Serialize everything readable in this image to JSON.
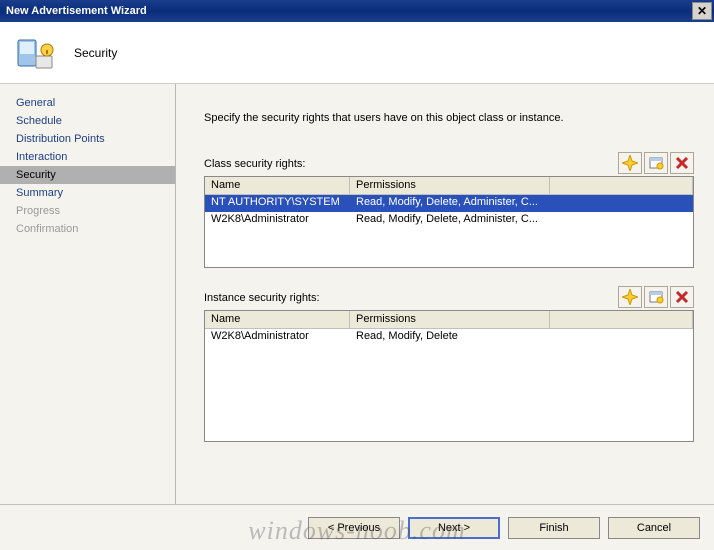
{
  "window": {
    "title": "New Advertisement Wizard",
    "close_glyph": "✕"
  },
  "header": {
    "title": "Security"
  },
  "sidebar": {
    "items": [
      {
        "label": "General",
        "state": "link"
      },
      {
        "label": "Schedule",
        "state": "link"
      },
      {
        "label": "Distribution Points",
        "state": "link"
      },
      {
        "label": "Interaction",
        "state": "link"
      },
      {
        "label": "Security",
        "state": "active"
      },
      {
        "label": "Summary",
        "state": "link"
      },
      {
        "label": "Progress",
        "state": "disabled"
      },
      {
        "label": "Confirmation",
        "state": "disabled"
      }
    ]
  },
  "content": {
    "instruction": "Specify the security rights that users have on this object class or instance.",
    "class_section": {
      "label": "Class security rights:",
      "columns": {
        "name": "Name",
        "permissions": "Permissions"
      },
      "rows": [
        {
          "name": "NT AUTHORITY\\SYSTEM",
          "permissions": "Read, Modify, Delete, Administer, C...",
          "selected": true
        },
        {
          "name": "W2K8\\Administrator",
          "permissions": "Read, Modify, Delete, Administer, C...",
          "selected": false
        }
      ]
    },
    "instance_section": {
      "label": "Instance security rights:",
      "columns": {
        "name": "Name",
        "permissions": "Permissions"
      },
      "rows": [
        {
          "name": "W2K8\\Administrator",
          "permissions": "Read, Modify, Delete",
          "selected": false
        }
      ]
    }
  },
  "footer": {
    "previous": "< Previous",
    "next": "Next >",
    "finish": "Finish",
    "cancel": "Cancel"
  },
  "watermark": "windows-noob.com"
}
